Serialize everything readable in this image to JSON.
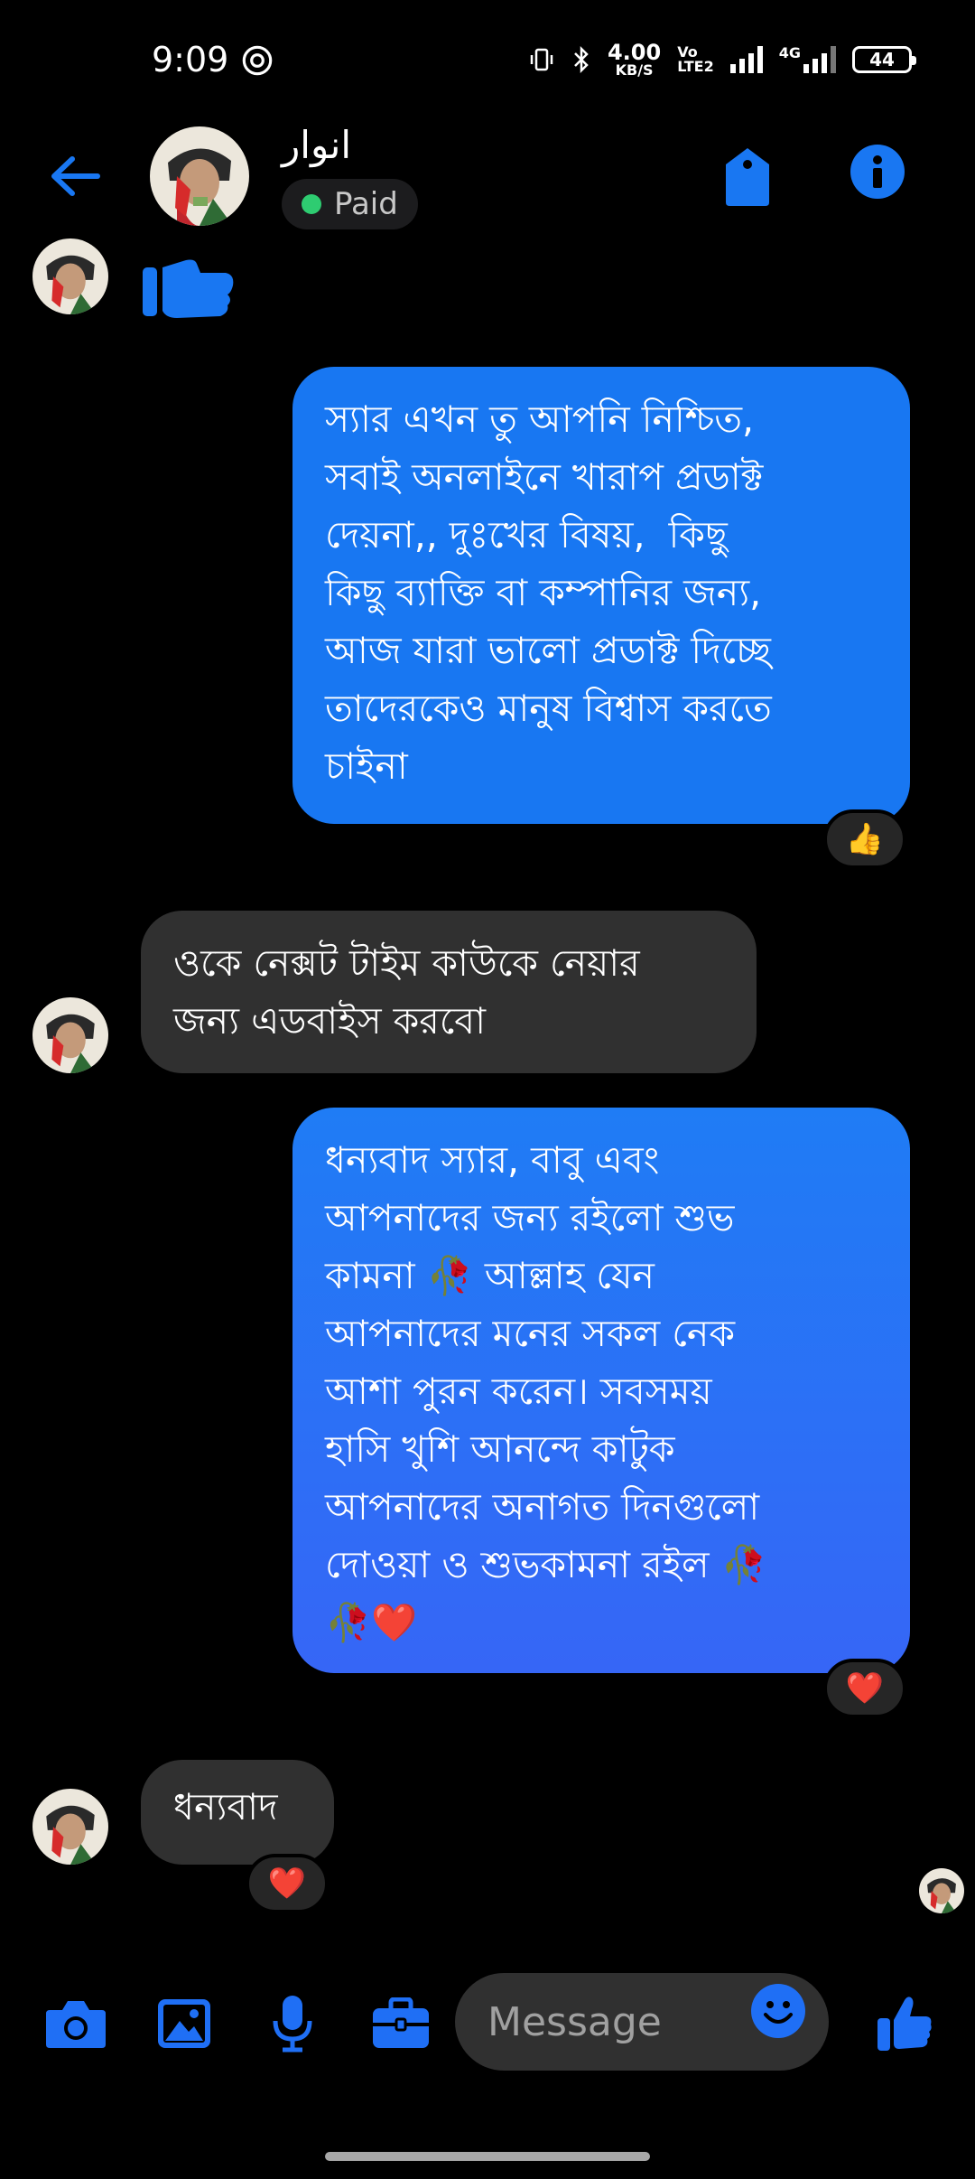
{
  "status_bar": {
    "time": "9:09",
    "net_speed_value": "4.00",
    "net_speed_unit": "KB/S",
    "volte_top": "Vo",
    "volte_bottom": "LTE2",
    "network_type": "4G",
    "battery": "44"
  },
  "header": {
    "contact_name": "انوار",
    "badge_label": "Paid",
    "badge_dot_color": "#2ecc71",
    "accent_color": "#1977f2",
    "icons": [
      "back-arrow-icon",
      "tag-icon",
      "info-icon"
    ]
  },
  "messages": [
    {
      "direction": "outgoing",
      "text": "স্যার এখন তু আপনি নিশ্চিত,\nসবাই অনলাইনে খারাপ প্রডাক্ট\nদেয়না,, দুঃখের বিষয়,  কিছু\nকিছু ব্যাক্তি বা কম্পানির জন্য,\nআজ যারা ভালো প্রডাক্ট দিচ্ছে\nতাদেরকেও মানুষ বিশ্বাস করতে\nচাইনা",
      "reaction": "👍"
    },
    {
      "direction": "incoming",
      "text": "ওকে নেক্সট টাইম কাউকে নেয়ার\nজন্য এডবাইস করবো"
    },
    {
      "direction": "outgoing",
      "text": "ধন্যবাদ স্যার, বাবু এবং\nআপনাদের জন্য রইলো শুভ\nকামনা 🥀 আল্লাহ যেন\nআপনাদের মনের সকল নেক\nআশা পুরন করেন। সবসময়\nহাসি খুশি আনন্দে কাটুক\nআপনাদের অনাগত দিনগুলো\nদোওয়া ও শুভকামনা রইল 🥀\n🥀❤️",
      "reaction": "❤️"
    },
    {
      "direction": "incoming",
      "text": "ধন্যবাদ",
      "reaction": "❤️"
    }
  ],
  "composer": {
    "placeholder": "Message",
    "icons": [
      "camera-icon",
      "image-icon",
      "microphone-icon",
      "briefcase-icon",
      "emoji-icon",
      "like-icon"
    ]
  }
}
